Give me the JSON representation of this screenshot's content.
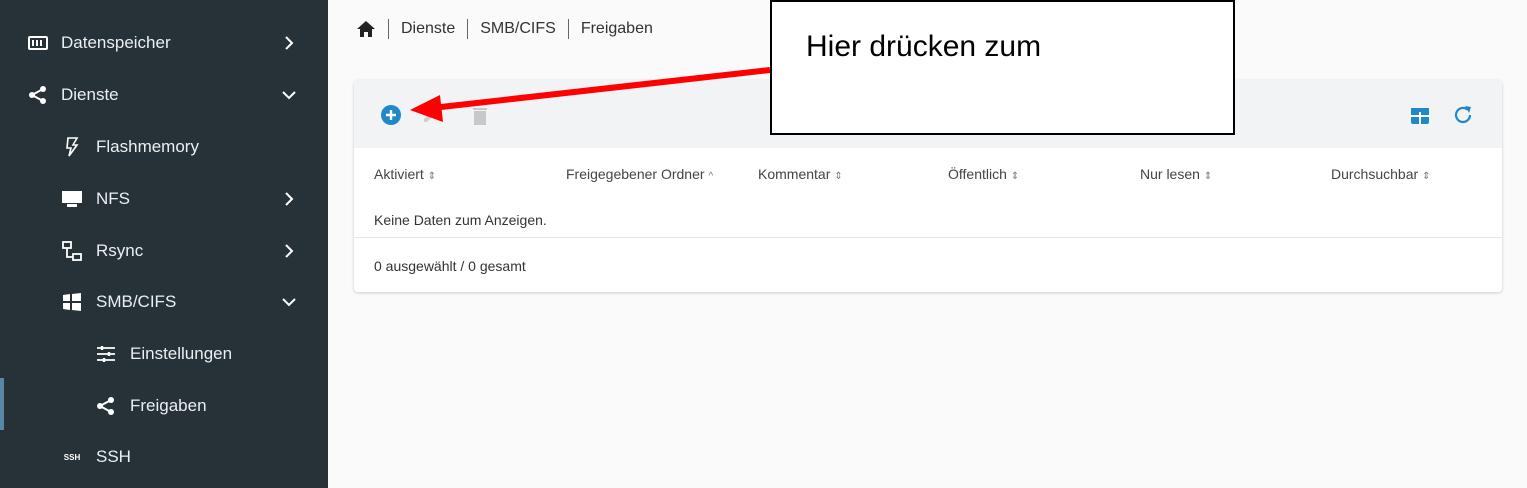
{
  "sidebar": {
    "items": [
      {
        "label": "Datenspeicher",
        "icon": "storage-icon",
        "chevron": "chevron-right-icon"
      },
      {
        "label": "Dienste",
        "icon": "share-icon",
        "chevron": "chevron-down-icon"
      },
      {
        "label": "Flashmemory",
        "icon": "flash-icon"
      },
      {
        "label": "NFS",
        "icon": "nfs-icon",
        "chevron": "chevron-right-icon"
      },
      {
        "label": "Rsync",
        "icon": "rsync-icon",
        "chevron": "chevron-right-icon"
      },
      {
        "label": "SMB/CIFS",
        "icon": "windows-icon",
        "chevron": "chevron-down-icon"
      },
      {
        "label": "Einstellungen",
        "icon": "tune-icon"
      },
      {
        "label": "Freigaben",
        "icon": "share-icon",
        "active": true
      },
      {
        "label": "SSH",
        "icon": "ssh-icon",
        "icon_text": "SSH"
      }
    ]
  },
  "breadcrumb": {
    "home_icon": "home-icon",
    "items": [
      "Dienste",
      "SMB/CIFS",
      "Freigaben"
    ]
  },
  "toolbar": {
    "add_icon": "add-circle-icon",
    "edit_icon": "edit-icon",
    "delete_icon": "delete-icon",
    "columns_icon": "table-columns-icon",
    "refresh_icon": "refresh-icon"
  },
  "table": {
    "columns": [
      {
        "label": "Aktiviert",
        "sort": "⇕"
      },
      {
        "label": "Freigegebener Ordner",
        "sort": "^"
      },
      {
        "label": "Kommentar",
        "sort": "⇕"
      },
      {
        "label": "Öffentlich",
        "sort": "⇕"
      },
      {
        "label": "Nur lesen",
        "sort": "⇕"
      },
      {
        "label": "Durchsuchbar",
        "sort": "⇕"
      }
    ],
    "empty_message": "Keine Daten zum Anzeigen.",
    "footer": "0 ausgewählt / 0 gesamt"
  },
  "annotation": {
    "text": "Hier drücken zum"
  },
  "colors": {
    "sidebar_bg": "#263238",
    "accent_blue": "#1e88c8",
    "arrow_red": "#ff0000"
  }
}
